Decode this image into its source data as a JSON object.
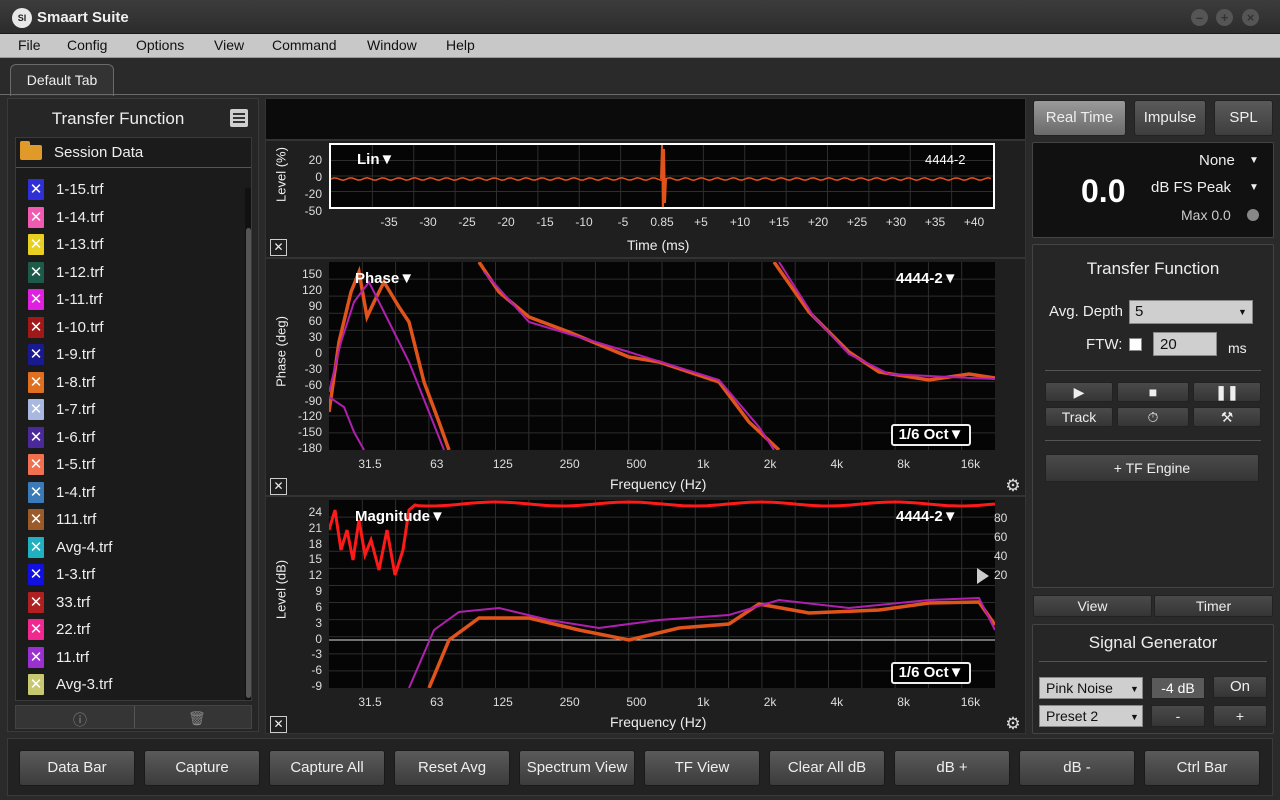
{
  "app": {
    "title": "Smaart Suite",
    "logo_text": "SI"
  },
  "menu": [
    "File",
    "Config",
    "Options",
    "View",
    "Command",
    "Window",
    "Help"
  ],
  "tabs": [
    {
      "label": "Default Tab",
      "active": true
    }
  ],
  "left_panel": {
    "title": "Transfer Function",
    "session_label": "Session Data",
    "files": [
      {
        "name": "1-15.trf",
        "color": "#2f2fd8"
      },
      {
        "name": "1-14.trf",
        "color": "#f05ab0"
      },
      {
        "name": "1-13.trf",
        "color": "#e8d020"
      },
      {
        "name": "1-12.trf",
        "color": "#1e5a4a"
      },
      {
        "name": "1-11.trf",
        "color": "#e020e0"
      },
      {
        "name": "1-10.trf",
        "color": "#a01818"
      },
      {
        "name": "1-9.trf",
        "color": "#1a1a90"
      },
      {
        "name": "1-8.trf",
        "color": "#e07020"
      },
      {
        "name": "1-7.trf",
        "color": "#a8b8e0"
      },
      {
        "name": "1-6.trf",
        "color": "#4a2a9a"
      },
      {
        "name": "1-5.trf",
        "color": "#f07050"
      },
      {
        "name": "1-4.trf",
        "color": "#3a7ab8"
      },
      {
        "name": "111.trf",
        "color": "#9a5a2a"
      },
      {
        "name": "Avg-4.trf",
        "color": "#20b0c0"
      },
      {
        "name": "1-3.trf",
        "color": "#1010e0"
      },
      {
        "name": "33.trf",
        "color": "#b02020"
      },
      {
        "name": "22.trf",
        "color": "#f02890"
      },
      {
        "name": "11.trf",
        "color": "#9a30d0"
      },
      {
        "name": "Avg-3.trf",
        "color": "#c8c870"
      }
    ]
  },
  "plots": {
    "impulse": {
      "mode": "Lin▼",
      "source": "4444-2",
      "ylabel": "Level (%)",
      "xlabel": "Time (ms)",
      "yticks": [
        "20",
        "0",
        "-20",
        "-50"
      ],
      "xticks": [
        "-35",
        "-30",
        "-25",
        "-20",
        "-15",
        "-10",
        "-5",
        "0.85",
        "+5",
        "+10",
        "+15",
        "+20",
        "+25",
        "+30",
        "+35",
        "+40"
      ]
    },
    "phase": {
      "mode": "Phase▼",
      "source": "4444-2▼",
      "smoothing": "1/6 Oct▼",
      "ylabel": "Phase (deg)",
      "xlabel": "Frequency (Hz)",
      "yticks": [
        "150",
        "120",
        "90",
        "60",
        "30",
        "0",
        "-30",
        "-60",
        "-90",
        "-120",
        "-150",
        "-180"
      ],
      "xticks": [
        "31.5",
        "63",
        "125",
        "250",
        "500",
        "1k",
        "2k",
        "4k",
        "8k",
        "16k"
      ]
    },
    "magnitude": {
      "mode": "Magnitude▼",
      "source": "4444-2▼",
      "smoothing": "1/6 Oct▼",
      "ylabel": "Level (dB)",
      "xlabel": "Frequency (Hz)",
      "yticks": [
        "24",
        "21",
        "18",
        "15",
        "12",
        "9",
        "6",
        "3",
        "0",
        "-3",
        "-6",
        "-9"
      ],
      "yticks_right": [
        "80",
        "60",
        "40",
        "20"
      ],
      "xticks": [
        "31.5",
        "63",
        "125",
        "250",
        "500",
        "1k",
        "2k",
        "4k",
        "8k",
        "16k"
      ]
    }
  },
  "right_panel": {
    "mode_buttons": [
      "Real Time",
      "Impulse",
      "SPL"
    ],
    "active_mode": "Real Time",
    "meter": {
      "value": "0.0",
      "weighting": "None",
      "type": "dB FS Peak",
      "max": "Max 0.0"
    },
    "tf": {
      "title": "Transfer Function",
      "avg_label": "Avg. Depth",
      "avg_value": "5",
      "ftw_label": "FTW:",
      "ftw_value": "20",
      "ftw_unit": "ms",
      "track_label": "Track",
      "engine_label": "+ TF Engine"
    },
    "view_tabs": [
      "View",
      "Timer"
    ],
    "signal_gen": {
      "title": "Signal Generator",
      "type": "Pink Noise",
      "level": "-4 dB",
      "on_label": "On",
      "preset": "Preset 2",
      "minus": "-",
      "plus": "+"
    }
  },
  "bottom_buttons": [
    "Data Bar",
    "Capture",
    "Capture All",
    "Reset Avg",
    "Spectrum View",
    "TF View",
    "Clear All dB",
    "dB +",
    "dB -",
    "Ctrl Bar"
  ],
  "colors": {
    "trace_orange": "#e0541c",
    "trace_purple": "#b020b0",
    "trace_red": "#ff1a1a"
  }
}
